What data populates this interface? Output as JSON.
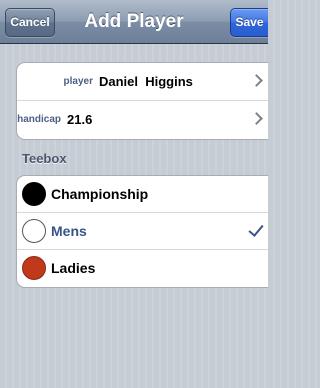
{
  "navbar": {
    "title": "Add Player",
    "cancel_label": "Cancel",
    "save_label": "Save"
  },
  "player_info": {
    "player": {
      "label": "player",
      "value": "Daniel  Higgins"
    },
    "handicap": {
      "label": "handicap",
      "value": "21.6"
    }
  },
  "teebox": {
    "header": "Teebox",
    "options": [
      {
        "label": "Championship",
        "color": "#000000",
        "selected": false
      },
      {
        "label": "Mens",
        "color": "#ffffff",
        "selected": true
      },
      {
        "label": "Ladies",
        "color": "#c0391b",
        "selected": false
      }
    ]
  },
  "colors": {
    "label_blue": "#4c5f85",
    "selected_text": "#385487",
    "background": "#c5ccd4"
  }
}
